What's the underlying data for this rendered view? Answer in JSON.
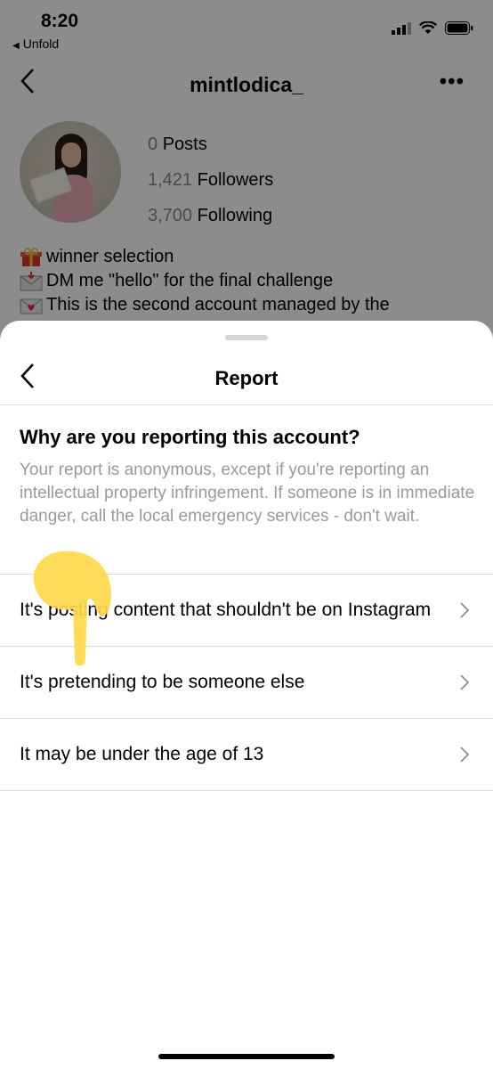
{
  "status_bar": {
    "time": "8:20",
    "back_app": "Unfold"
  },
  "profile": {
    "username": "mintlodica_",
    "posts_count": "0",
    "posts_label": "Posts",
    "followers_count": "1,421",
    "followers_label": "Followers",
    "following_count": "3,700",
    "following_label": "Following",
    "bio": [
      "winner selection",
      "DM me \"hello\" for the final challenge",
      " This is the second account managed by the"
    ]
  },
  "report_sheet": {
    "title": "Report",
    "question": "Why are you reporting this account?",
    "explanation": "Your report is anonymous, except if you're reporting an intellectual property infringement. If someone is in immediate danger, call the local emergency services - don't wait.",
    "options": [
      "It's posting content that shouldn't be on Instagram",
      "It's pretending to be someone else",
      "It may be under the age of 13"
    ]
  },
  "colors": {
    "annotation": "#FFD84D",
    "divider": "#DBDBDB",
    "secondary_text": "#9A9A9A"
  },
  "icons": [
    "back-chevron-icon",
    "more-icon",
    "chevron-right-icon",
    "signal-icon",
    "wifi-icon",
    "battery-icon",
    "gift-icon",
    "envelope-icon",
    "love-letter-icon"
  ]
}
